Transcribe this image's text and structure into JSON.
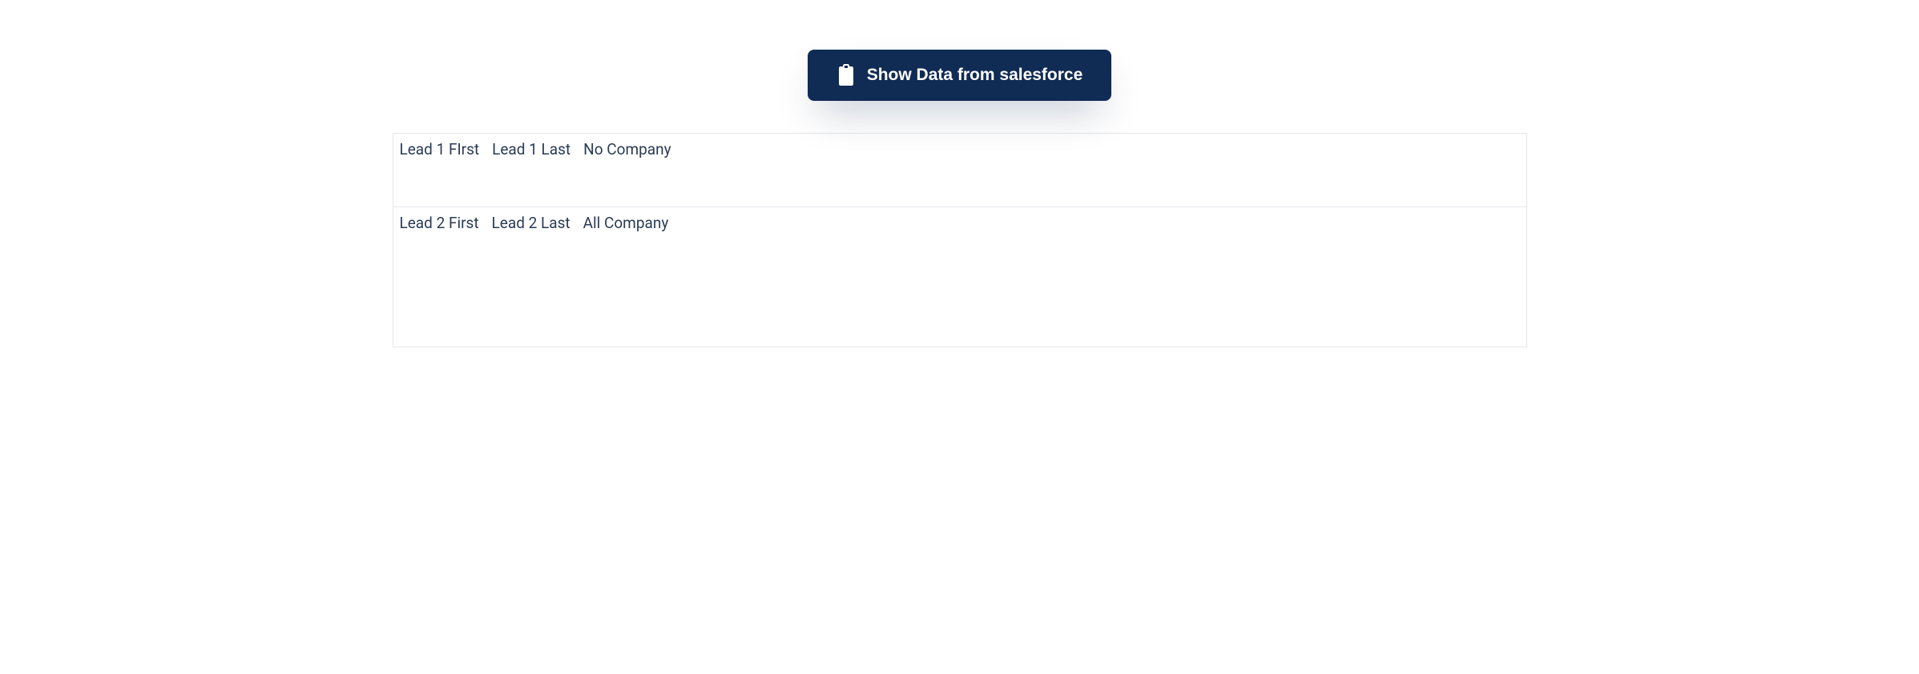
{
  "button": {
    "label": "Show Data from salesforce"
  },
  "rows": [
    {
      "first": "Lead 1 FIrst",
      "last": "Lead 1 Last",
      "company": "No Company"
    },
    {
      "first": "Lead 2 First",
      "last": "Lead 2 Last",
      "company": "All Company"
    }
  ]
}
